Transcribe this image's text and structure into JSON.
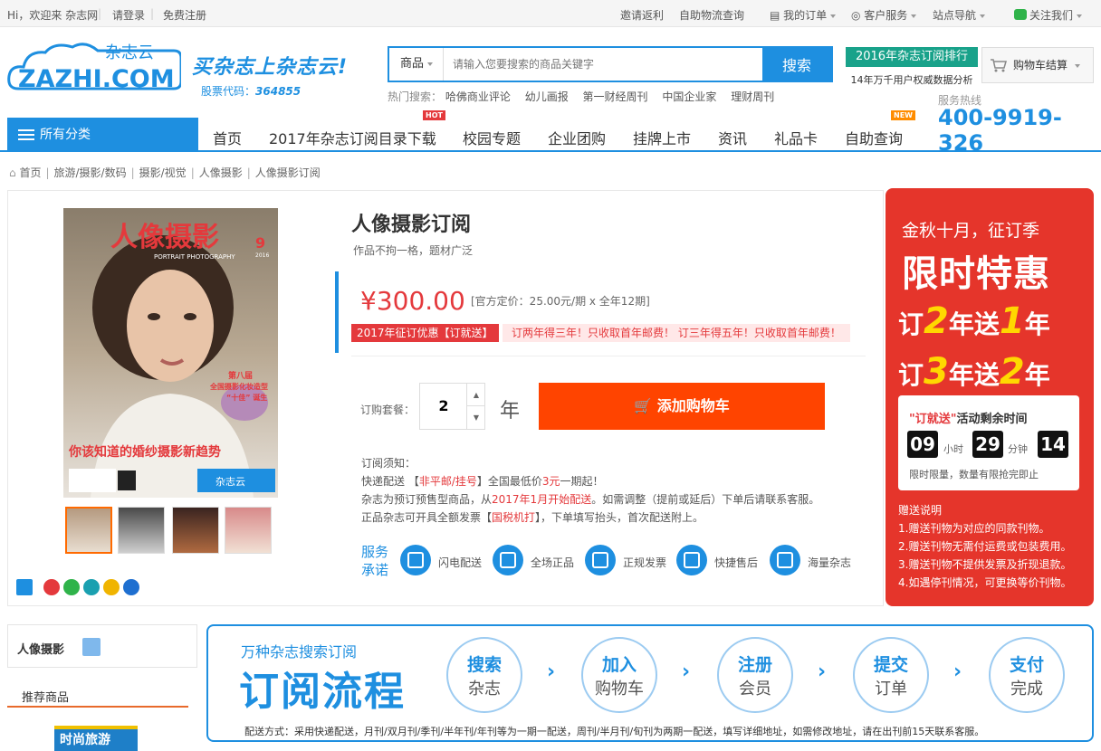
{
  "topbar": {
    "greeting": "Hi，欢迎来 杂志网",
    "login": "请登录",
    "register": "免费注册",
    "invite": "邀请返利",
    "logistics": "自助物流查询",
    "orders": "我的订单",
    "service": "客户服务",
    "site_nav": "站点导航",
    "follow": "关注我们"
  },
  "header": {
    "logo_cn": "杂志云",
    "logo_en": "ZAZHI.COM",
    "slogan": "买杂志上杂志云!",
    "stock_label": "股票代码：",
    "stock_code": "364855",
    "search_category": "商品",
    "search_placeholder": "请输入您要搜索的商品关键字",
    "search_button": "搜索",
    "hot_label": "热门搜索：",
    "hot_terms": [
      "哈佛商业评论",
      "幼儿画报",
      "第一财经周刊",
      "中国企业家",
      "理财周刊"
    ],
    "rank_title": "2016年杂志订阅排行",
    "rank_sub": "14年万千用户权威数据分析",
    "cart": "购物车结算",
    "hotline_label": "服务热线",
    "hotline": "400-9919-326"
  },
  "nav": {
    "all_categories": "所有分类",
    "items": [
      "首页",
      "2017年杂志订阅目录下载",
      "校园专题",
      "企业团购",
      "挂牌上市",
      "资讯",
      "礼品卡",
      "自助查询"
    ],
    "hot_badge": "HOT",
    "new_badge": "NEW"
  },
  "breadcrumb": [
    "首页",
    "旅游/摄影/数码",
    "摄影/视觉",
    "人像摄影",
    "人像摄影订阅"
  ],
  "product": {
    "cover_title": "人像摄影",
    "cover_en": "PORTRAIT PHOTOGRAPHY",
    "cover_issue": "9",
    "cover_year": "2016",
    "cover_side_1": "第八届",
    "cover_side_2": "全国摄影化妆造型",
    "cover_side_3": "“十佳” 诞生",
    "cover_headline": "你该知道的婚纱摄影新趋势",
    "cover_brand": "杂志云",
    "title": "人像摄影订阅",
    "subtitle": "作品不拘一格，题材广泛",
    "price": "¥300.00",
    "price_note": "[官方定价：25.00元/期 x 全年12期]",
    "promo_tag": "2017年征订优惠【订就送】",
    "promo_text": "订两年得三年！只收取首年邮费！ 订三年得五年！只收取首年邮费！",
    "qty_label": "订购套餐：",
    "qty_value": "2",
    "qty_unit": "年",
    "add_cart": "添加购物车",
    "notice_title": "订阅须知：",
    "notice_1a": "快递配送 【",
    "notice_1b": "非平邮/挂号",
    "notice_1c": "】全国最低价",
    "notice_1d": "3元",
    "notice_1e": "一期起！",
    "notice_2a": "杂志为预订预售型商品，从",
    "notice_2b": "2017年1月开始配送",
    "notice_2c": "。如需调整（提前或延后）下单后请联系客服。",
    "notice_3a": "正品杂志可开具全额发票【",
    "notice_3b": "国税机打",
    "notice_3c": "】，下单填写抬头，首次配送附上。",
    "service_title": "服务承诺",
    "services": [
      "闪电配送",
      "全场正品",
      "正规发票",
      "快捷售后",
      "海量杂志"
    ]
  },
  "promo": {
    "line1": "金秋十月，征订季",
    "line2": "限时特惠",
    "l3_a": "订",
    "l3_n1": "2",
    "l3_b": "年送",
    "l3_n2": "1",
    "l3_c": "年",
    "l4_a": "订",
    "l4_n1": "3",
    "l4_b": "年送",
    "l4_n2": "2",
    "l4_c": "年",
    "cd_highlight": "\"订就送\"",
    "cd_title": "活动剩余时间",
    "hours": "09",
    "hours_unit": "小时",
    "minutes": "29",
    "minutes_unit": "分钟",
    "seconds": "14",
    "cd_foot": "限时限量，数量有限抢完即止",
    "gift_title": "赠送说明",
    "gifts": [
      "1.赠送刊物为对应的同款刊物。",
      "2.赠送刊物无需付运费或包装费用。",
      "3.赠送刊物不提供发票及折现退款。",
      "4.如遇停刊情况，可更换等价刊物。"
    ]
  },
  "sidebar": {
    "title": "人像摄影",
    "recommend": "推荐商品",
    "book": "时尚旅游"
  },
  "flow": {
    "sub": "万种杂志搜索订阅",
    "main": "订阅流程",
    "steps": [
      {
        "a": "搜索",
        "b": "杂志"
      },
      {
        "a": "加入",
        "b": "购物车"
      },
      {
        "a": "注册",
        "b": "会员"
      },
      {
        "a": "提交",
        "b": "订单"
      },
      {
        "a": "支付",
        "b": "完成"
      }
    ],
    "arrow": "›",
    "note": "配送方式：采用快递配送，月刊/双月刊/季刊/半年刊/年刊等为一期一配送，周刊/半月刊/旬刊为两期一配送，填写详细地址，如需修改地址，请在出刊前15天联系客服。"
  },
  "colors": {
    "brand_blue": "#1e8fe0",
    "price_red": "#e4393c",
    "cart_orange": "#ff4400",
    "promo_red": "#e5352b"
  }
}
